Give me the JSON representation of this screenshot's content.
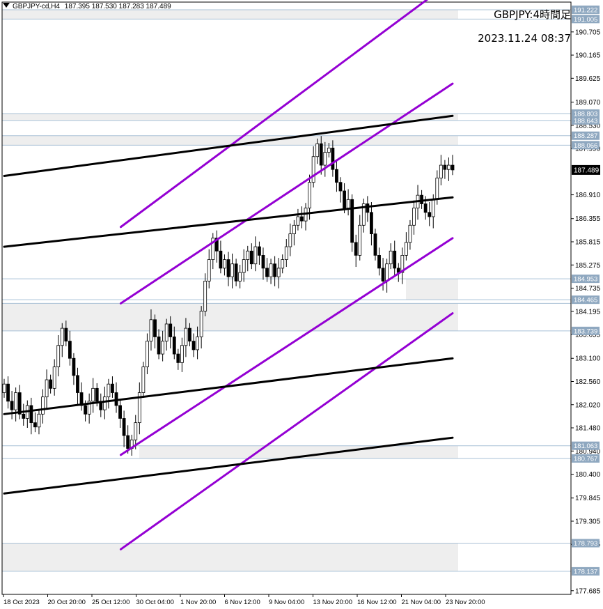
{
  "header": {
    "symbol": "GBPJPY-cd,H4",
    "ohlc": "187.395 187.530 187.283 187.489",
    "title": "GBPJPY:4時間足",
    "datetime": "2023.11.24 08:37"
  },
  "colors": {
    "zone_fill": "#eeeeee",
    "zone_line": "#a9c0d6",
    "channel_purple": "#9400d3",
    "channel_black": "#000000",
    "candle": "#000000",
    "price_tag": "#000000",
    "level_tag": "#8fa8c0"
  },
  "chart_data": {
    "type": "candlestick",
    "y_range": [
      177.6,
      191.4
    ],
    "current_price": "187.489",
    "y_ticks": [
      "190.705",
      "190.165",
      "189.625",
      "189.070",
      "188.530",
      "187.990",
      "186.910",
      "186.355",
      "185.815",
      "185.275",
      "184.735",
      "184.195",
      "183.655",
      "183.100",
      "182.560",
      "182.020",
      "181.480",
      "180.940",
      "180.400",
      "179.845",
      "179.305",
      "178.765",
      "177.685"
    ],
    "x_ticks": [
      "18 Oct 2023",
      "20 Oct 20:00",
      "25 Oct 12:00",
      "30 Oct 04:00",
      "1 Nov 20:00",
      "6 Nov 12:00",
      "9 Nov 04:00",
      "13 Nov 20:00",
      "16 Nov 12:00",
      "21 Nov 04:00",
      "23 Nov 20:00"
    ],
    "level_labels": [
      "191.222",
      "191.005",
      "188.803",
      "188.643",
      "188.287",
      "188.066",
      "184.953",
      "184.465",
      "183.739",
      "181.063",
      "180.767",
      "178.793",
      "178.137"
    ],
    "zones": [
      {
        "top": 191.222,
        "bottom": 191.005,
        "extends": "full"
      },
      {
        "top": 188.803,
        "bottom": 188.643,
        "extends": "full"
      },
      {
        "top": 188.287,
        "bottom": 188.066,
        "extends": "full"
      },
      {
        "top": 184.953,
        "bottom": 184.465,
        "extends": "partial"
      },
      {
        "top": 184.38,
        "bottom": 183.739,
        "extends": "full"
      },
      {
        "top": 181.063,
        "bottom": 180.767,
        "extends": "partial"
      },
      {
        "top": 178.793,
        "bottom": 178.137,
        "extends": "full"
      }
    ],
    "channels": [
      {
        "color": "purple",
        "t1": 0.26,
        "p1": 186.16,
        "t2": 1.0,
        "p2": 191.9
      },
      {
        "color": "purple",
        "t1": 0.26,
        "p1": 184.38,
        "t2": 1.0,
        "p2": 189.5
      },
      {
        "color": "purple",
        "t1": 0.26,
        "p1": 180.85,
        "t2": 1.0,
        "p2": 185.9
      },
      {
        "color": "purple",
        "t1": 0.26,
        "p1": 178.65,
        "t2": 1.0,
        "p2": 184.15
      },
      {
        "color": "black",
        "t1": 0.0,
        "p1": 187.35,
        "t2": 1.0,
        "p2": 188.75
      },
      {
        "color": "black",
        "t1": 0.0,
        "p1": 185.7,
        "t2": 1.0,
        "p2": 186.85
      },
      {
        "color": "black",
        "t1": 0.0,
        "p1": 181.8,
        "t2": 1.0,
        "p2": 183.1
      },
      {
        "color": "black",
        "t1": 0.0,
        "p1": 179.95,
        "t2": 1.0,
        "p2": 181.25
      }
    ],
    "closes": [
      182.5,
      182.1,
      181.9,
      182.3,
      181.8,
      181.7,
      182.0,
      181.6,
      181.5,
      181.8,
      182.2,
      182.6,
      182.4,
      182.9,
      183.4,
      183.8,
      183.5,
      183.1,
      182.7,
      182.3,
      182.0,
      181.8,
      182.1,
      182.4,
      182.1,
      181.9,
      182.2,
      182.5,
      182.3,
      182.0,
      181.7,
      181.3,
      181.0,
      181.2,
      181.6,
      182.3,
      182.9,
      183.5,
      184.0,
      183.6,
      183.2,
      183.5,
      183.9,
      183.6,
      183.2,
      183.0,
      183.4,
      183.8,
      183.5,
      183.3,
      183.6,
      184.2,
      184.9,
      185.4,
      185.9,
      185.6,
      185.2,
      185.4,
      185.0,
      185.3,
      184.9,
      185.1,
      185.4,
      185.6,
      185.3,
      185.7,
      185.5,
      185.2,
      185.0,
      185.3,
      185.0,
      185.2,
      185.4,
      185.7,
      186.0,
      186.2,
      186.4,
      186.3,
      186.6,
      187.2,
      187.8,
      188.1,
      187.6,
      187.9,
      188.0,
      187.5,
      187.2,
      187.0,
      186.6,
      186.8,
      185.8,
      185.5,
      186.2,
      186.7,
      186.5,
      186.0,
      185.5,
      185.2,
      184.9,
      185.3,
      185.6,
      185.2,
      185.1,
      185.5,
      185.8,
      186.2,
      186.6,
      186.9,
      186.7,
      186.5,
      186.4,
      186.8,
      187.3,
      187.6,
      187.5,
      187.6,
      187.489
    ]
  }
}
